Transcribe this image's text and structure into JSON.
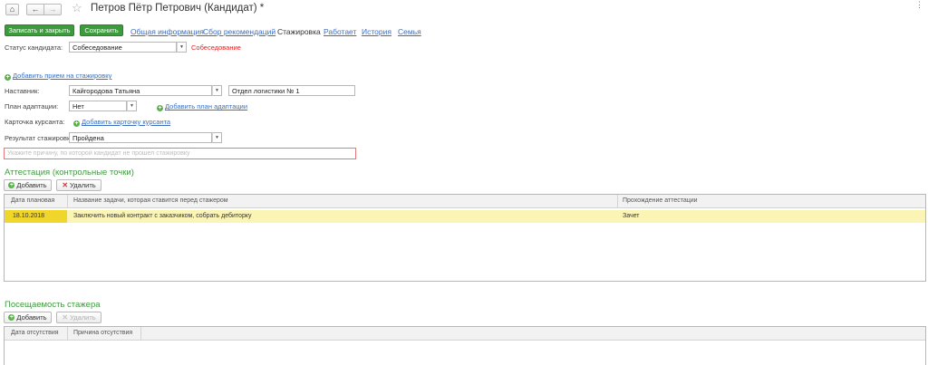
{
  "header": {
    "title": "Петров Пётр Петрович (Кандидат) *",
    "home_icon": "home-icon",
    "back_icon": "arrow-left-icon",
    "forward_icon": "arrow-right-icon",
    "star_icon": "star-icon"
  },
  "toolbar": {
    "save_close_label": "Записать и закрыть",
    "save_label": "Сохранить"
  },
  "tabs": [
    {
      "label": "Общая информация"
    },
    {
      "label": "Сбор рекомендаций"
    },
    {
      "label": "Стажировка"
    },
    {
      "label": "Работает"
    },
    {
      "label": "История"
    },
    {
      "label": "Семья"
    }
  ],
  "status": {
    "label": "Статус кандидата:",
    "value": "Собеседование",
    "hint": "Собеседование"
  },
  "add_internship_link": "Добавить прием на стажировку",
  "mentor": {
    "label": "Наставник:",
    "value": "Кайгородова Татьяна",
    "department": "Отдел логистики № 1"
  },
  "adaptation_plan": {
    "label": "План адаптации:",
    "value": "Нет",
    "add_link": "Добавить план адаптации"
  },
  "cadet_card": {
    "label": "Карточка курсанта:",
    "add_link": "Добавить карточку курсанта"
  },
  "result": {
    "label": "Результат стажировки:",
    "value": "Пройдена"
  },
  "reason": {
    "placeholder": "Укажите причину, по которой кандидат не прошел стажировку"
  },
  "attestation": {
    "title": "Аттестация (контрольные точки)",
    "add_label": "Добавить",
    "delete_label": "Удалить",
    "columns": [
      "Дата плановая",
      "Название задачи, которая ставится перед стажером",
      "Прохождение аттестации"
    ],
    "rows": [
      {
        "date": "18.10.2018",
        "task": "Заключить новый контракт с заказчиком, собрать дебиторку",
        "result": "Зачет"
      }
    ]
  },
  "attendance": {
    "title": "Посещаемость стажера",
    "add_label": "Добавить",
    "delete_label": "Удалить",
    "columns": [
      "Дата отсутствия",
      "Причина отсутствия"
    ]
  },
  "colors": {
    "accent_green": "#3d9a3d",
    "link_blue": "#3a6fbf",
    "selected_row": "#fbf5b5",
    "selected_cell": "#f0d52a",
    "error_red": "#e02424"
  }
}
